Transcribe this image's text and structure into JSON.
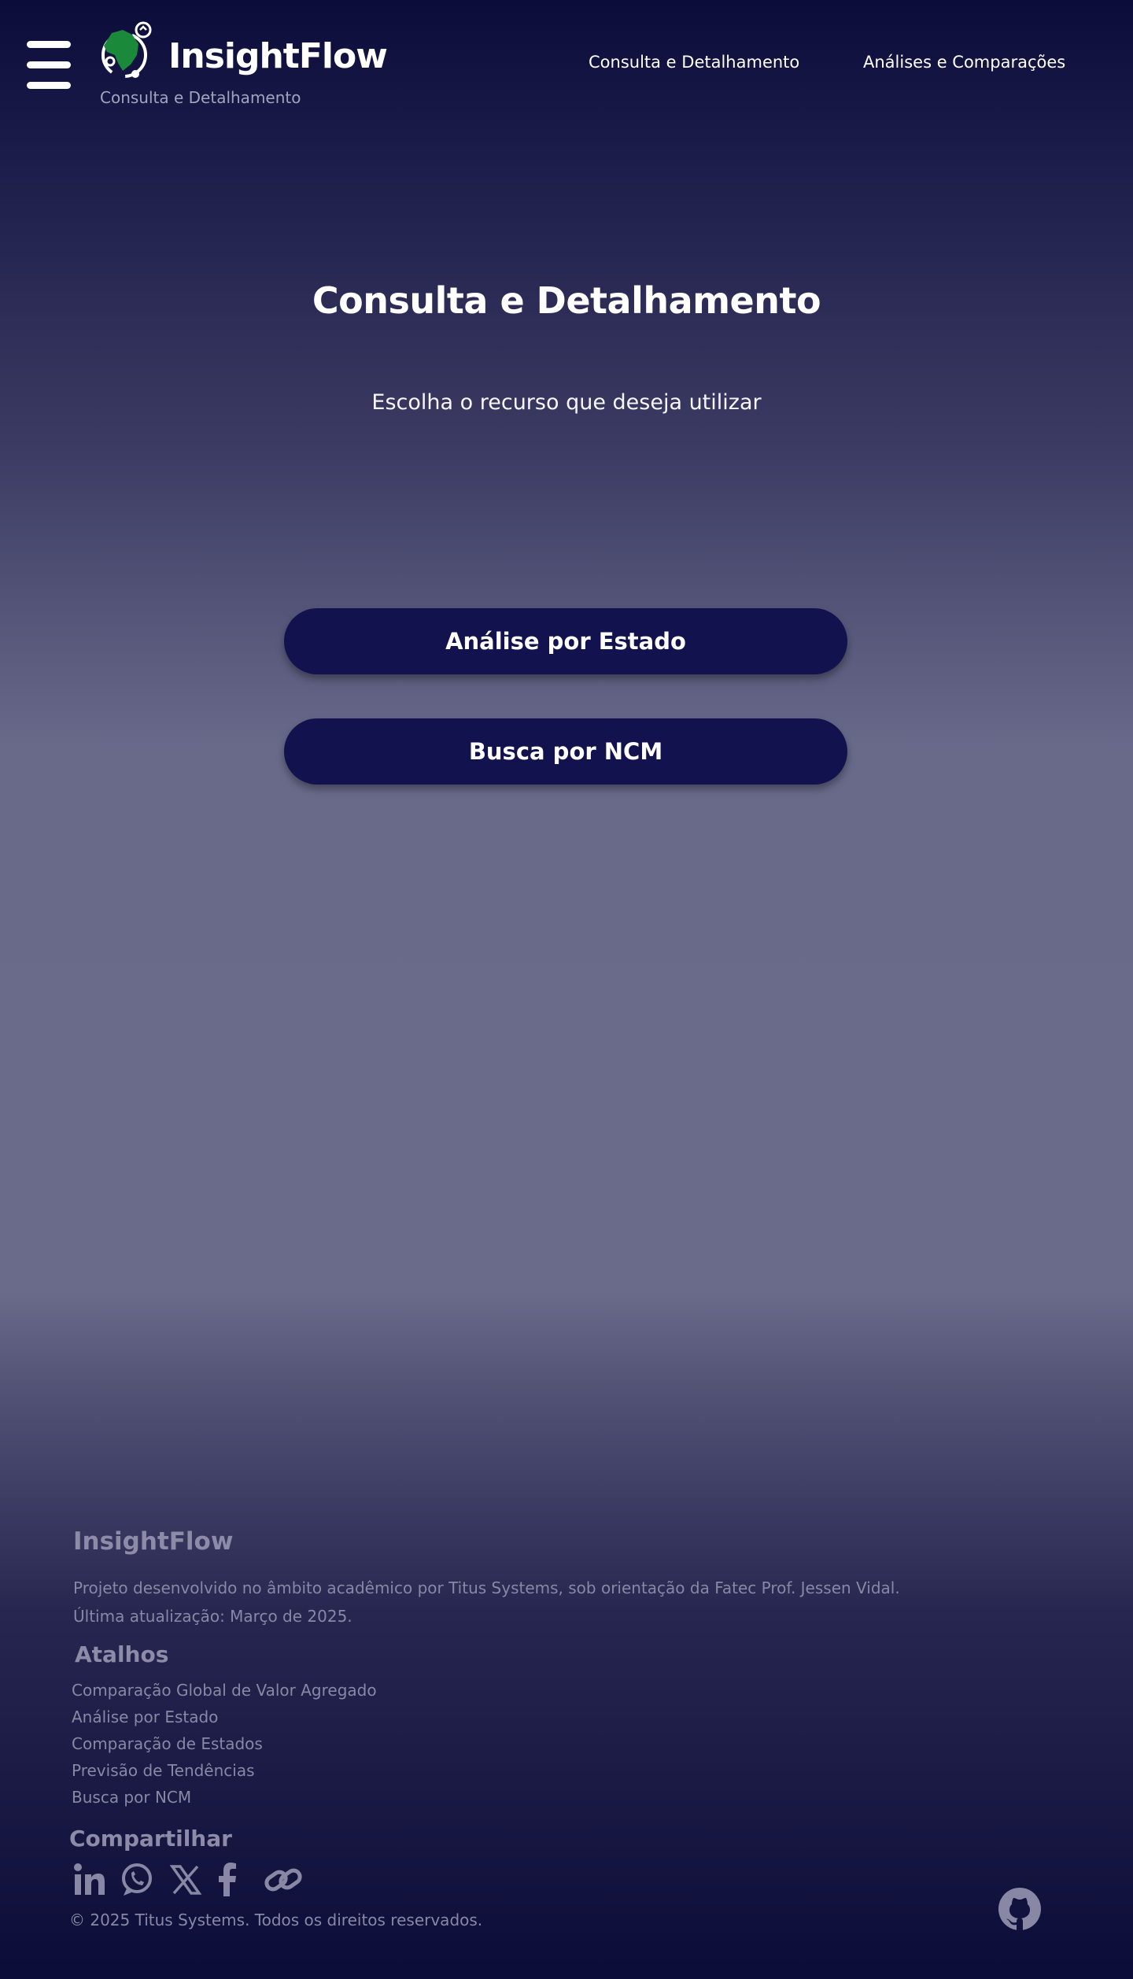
{
  "header": {
    "brand_name": "InsightFlow",
    "brand_subtitle": "Consulta e Detalhamento",
    "nav": [
      {
        "label": "Consulta e Detalhamento"
      },
      {
        "label": "Análises e Comparações"
      }
    ]
  },
  "main": {
    "title": "Consulta e Detalhamento",
    "subtitle": "Escolha o recurso que deseja utilizar",
    "buttons": [
      {
        "label": "Análise por Estado"
      },
      {
        "label": "Busca por NCM"
      }
    ]
  },
  "footer": {
    "title": "InsightFlow",
    "description": "Projeto desenvolvido no âmbito acadêmico por Titus Systems, sob orientação da Fatec Prof. Jessen Vidal.",
    "updated": "Última atualização: Março de 2025.",
    "shortcuts_title": "Atalhos",
    "shortcuts": [
      {
        "label": "Comparação Global de Valor Agregado"
      },
      {
        "label": "Análise por Estado"
      },
      {
        "label": "Comparação de Estados"
      },
      {
        "label": "Previsão de Tendências"
      },
      {
        "label": "Busca por NCM"
      }
    ],
    "share_title": "Compartilhar",
    "share_icons": [
      "linkedin-icon",
      "whatsapp-icon",
      "x-icon",
      "facebook-icon",
      "link-icon"
    ],
    "copyright": "© 2025 Titus Systems. Todos os direitos reservados.",
    "github_icon": "github-icon"
  },
  "colors": {
    "background_top": "#0c0c3a",
    "background_mid": "#696a8a",
    "button_bg": "#12124e",
    "logo_green": "#1a8a3a",
    "footer_text": "#8888a5"
  }
}
